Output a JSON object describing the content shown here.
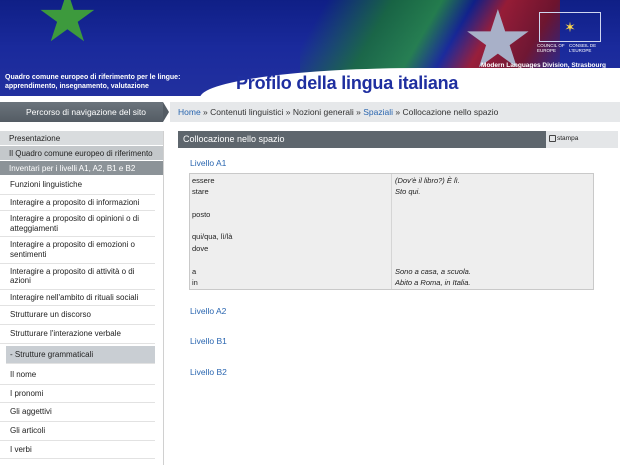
{
  "header": {
    "subtitle_line1": "Quadro comune europeo di riferimento per le lingue:",
    "subtitle_line2": "apprendimento, insegnamento, valutazione",
    "title": "Profilo della lingua italiana",
    "division": "Modern Languages Division, Strasbourg",
    "logo_text_left": "COUNCIL OF EUROPE",
    "logo_text_right": "CONSEIL DE L'EUROPE"
  },
  "nav": {
    "label": "Percorso di navigazione del sito",
    "breadcrumb": [
      {
        "text": "Home",
        "link": true
      },
      {
        "text": " » ",
        "link": false
      },
      {
        "text": "Contenuti linguistici",
        "link": false
      },
      {
        "text": " » ",
        "link": false
      },
      {
        "text": "Nozioni generali",
        "link": false
      },
      {
        "text": " » ",
        "link": false
      },
      {
        "text": "Spaziali",
        "link": true
      },
      {
        "text": " » ",
        "link": false
      },
      {
        "text": "Collocazione nello spazio",
        "link": false
      }
    ]
  },
  "sidebar": {
    "section1": "Presentazione",
    "section2": "Il Quadro comune europeo di riferimento",
    "section3": "Inventari per i livelli A1, A2, B1 e B2",
    "items": [
      "Funzioni linguistiche",
      "Interagire a proposito di informazioni",
      "Interagire a proposito di opinioni o di atteggiamenti",
      "Interagire a proposito di emozioni o sentimenti",
      "Interagire a proposito di attività o di azioni",
      "Interagire nell'ambito di rituali sociali",
      "Strutturare un discorso",
      "Strutturare l'interazione verbale"
    ],
    "selected": "- Strutture grammaticali",
    "subitems": [
      "Il nome",
      "I pronomi",
      "Gli aggettivi",
      "Gli articoli",
      "I verbi"
    ]
  },
  "main": {
    "panel_title": "Collocazione nello spazio",
    "print_label": "stampa",
    "levels": [
      "Livello A1",
      "Livello A2",
      "Livello B1",
      "Livello B2"
    ],
    "rows": [
      {
        "term": "essere",
        "example": "(Dov'è il libro?) È lì."
      },
      {
        "term": "stare",
        "example": "Sto qui."
      },
      {
        "term": "posto",
        "example": ""
      },
      {
        "term": "qui/qua, lì/là",
        "example": ""
      },
      {
        "term": "dove",
        "example": ""
      },
      {
        "term": "a",
        "example": "Sono a casa, a scuola."
      },
      {
        "term": "in",
        "example": "Abito a Roma, in Italia."
      }
    ]
  },
  "colors": {
    "banner": "#1a2a9c",
    "link": "#2a66b0",
    "panel_head": "#5e666d"
  }
}
